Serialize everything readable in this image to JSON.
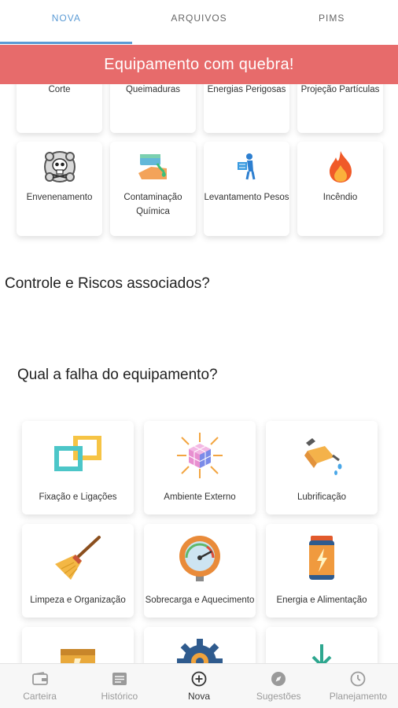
{
  "tabs": [
    {
      "label": "NOVA",
      "active": true
    },
    {
      "label": "ARQUIVOS",
      "active": false
    },
    {
      "label": "PIMS",
      "active": false
    }
  ],
  "banner": {
    "text": "Equipamento com quebra!",
    "color": "#e76b6b"
  },
  "risks_row1": [
    {
      "label": "Corte"
    },
    {
      "label": "Queimaduras"
    },
    {
      "label": "Energias Perigosas"
    },
    {
      "label": "Projeção Partículas"
    }
  ],
  "risks_row2": [
    {
      "label": "Envenenamento",
      "icon": "skull-icon"
    },
    {
      "label": "Contaminação Química",
      "icon": "chemical-icon"
    },
    {
      "label": "Levantamento Pesos",
      "icon": "lifting-icon"
    },
    {
      "label": "Incêndio",
      "icon": "fire-icon"
    }
  ],
  "section_controls": "Controle e Riscos associados?",
  "section_failure": "Qual a falha do equipamento?",
  "failures": [
    {
      "label": "Fixação e Ligações",
      "icon": "link-squares-icon"
    },
    {
      "label": "Ambiente Externo",
      "icon": "cube-arrows-icon"
    },
    {
      "label": "Lubrificação",
      "icon": "oil-can-icon"
    },
    {
      "label": "Limpeza e Organização",
      "icon": "broom-icon"
    },
    {
      "label": "Sobrecarga e Aquecimento",
      "icon": "gauge-icon"
    },
    {
      "label": "Energia e Alimentação",
      "icon": "battery-icon"
    },
    {
      "label": "",
      "icon": "box-icon"
    },
    {
      "label": "",
      "icon": "gear-icon"
    },
    {
      "label": "",
      "icon": "download-icon"
    }
  ],
  "bottom_nav": [
    {
      "label": "Carteira",
      "icon": "wallet-icon",
      "active": false
    },
    {
      "label": "Histórico",
      "icon": "history-icon",
      "active": false
    },
    {
      "label": "Nova",
      "icon": "add-circle-icon",
      "active": true
    },
    {
      "label": "Sugestões",
      "icon": "compass-icon",
      "active": false
    },
    {
      "label": "Planejamento",
      "icon": "clock-icon",
      "active": false
    }
  ],
  "colors": {
    "accent": "#5b9bd5",
    "banner": "#e76b6b"
  }
}
